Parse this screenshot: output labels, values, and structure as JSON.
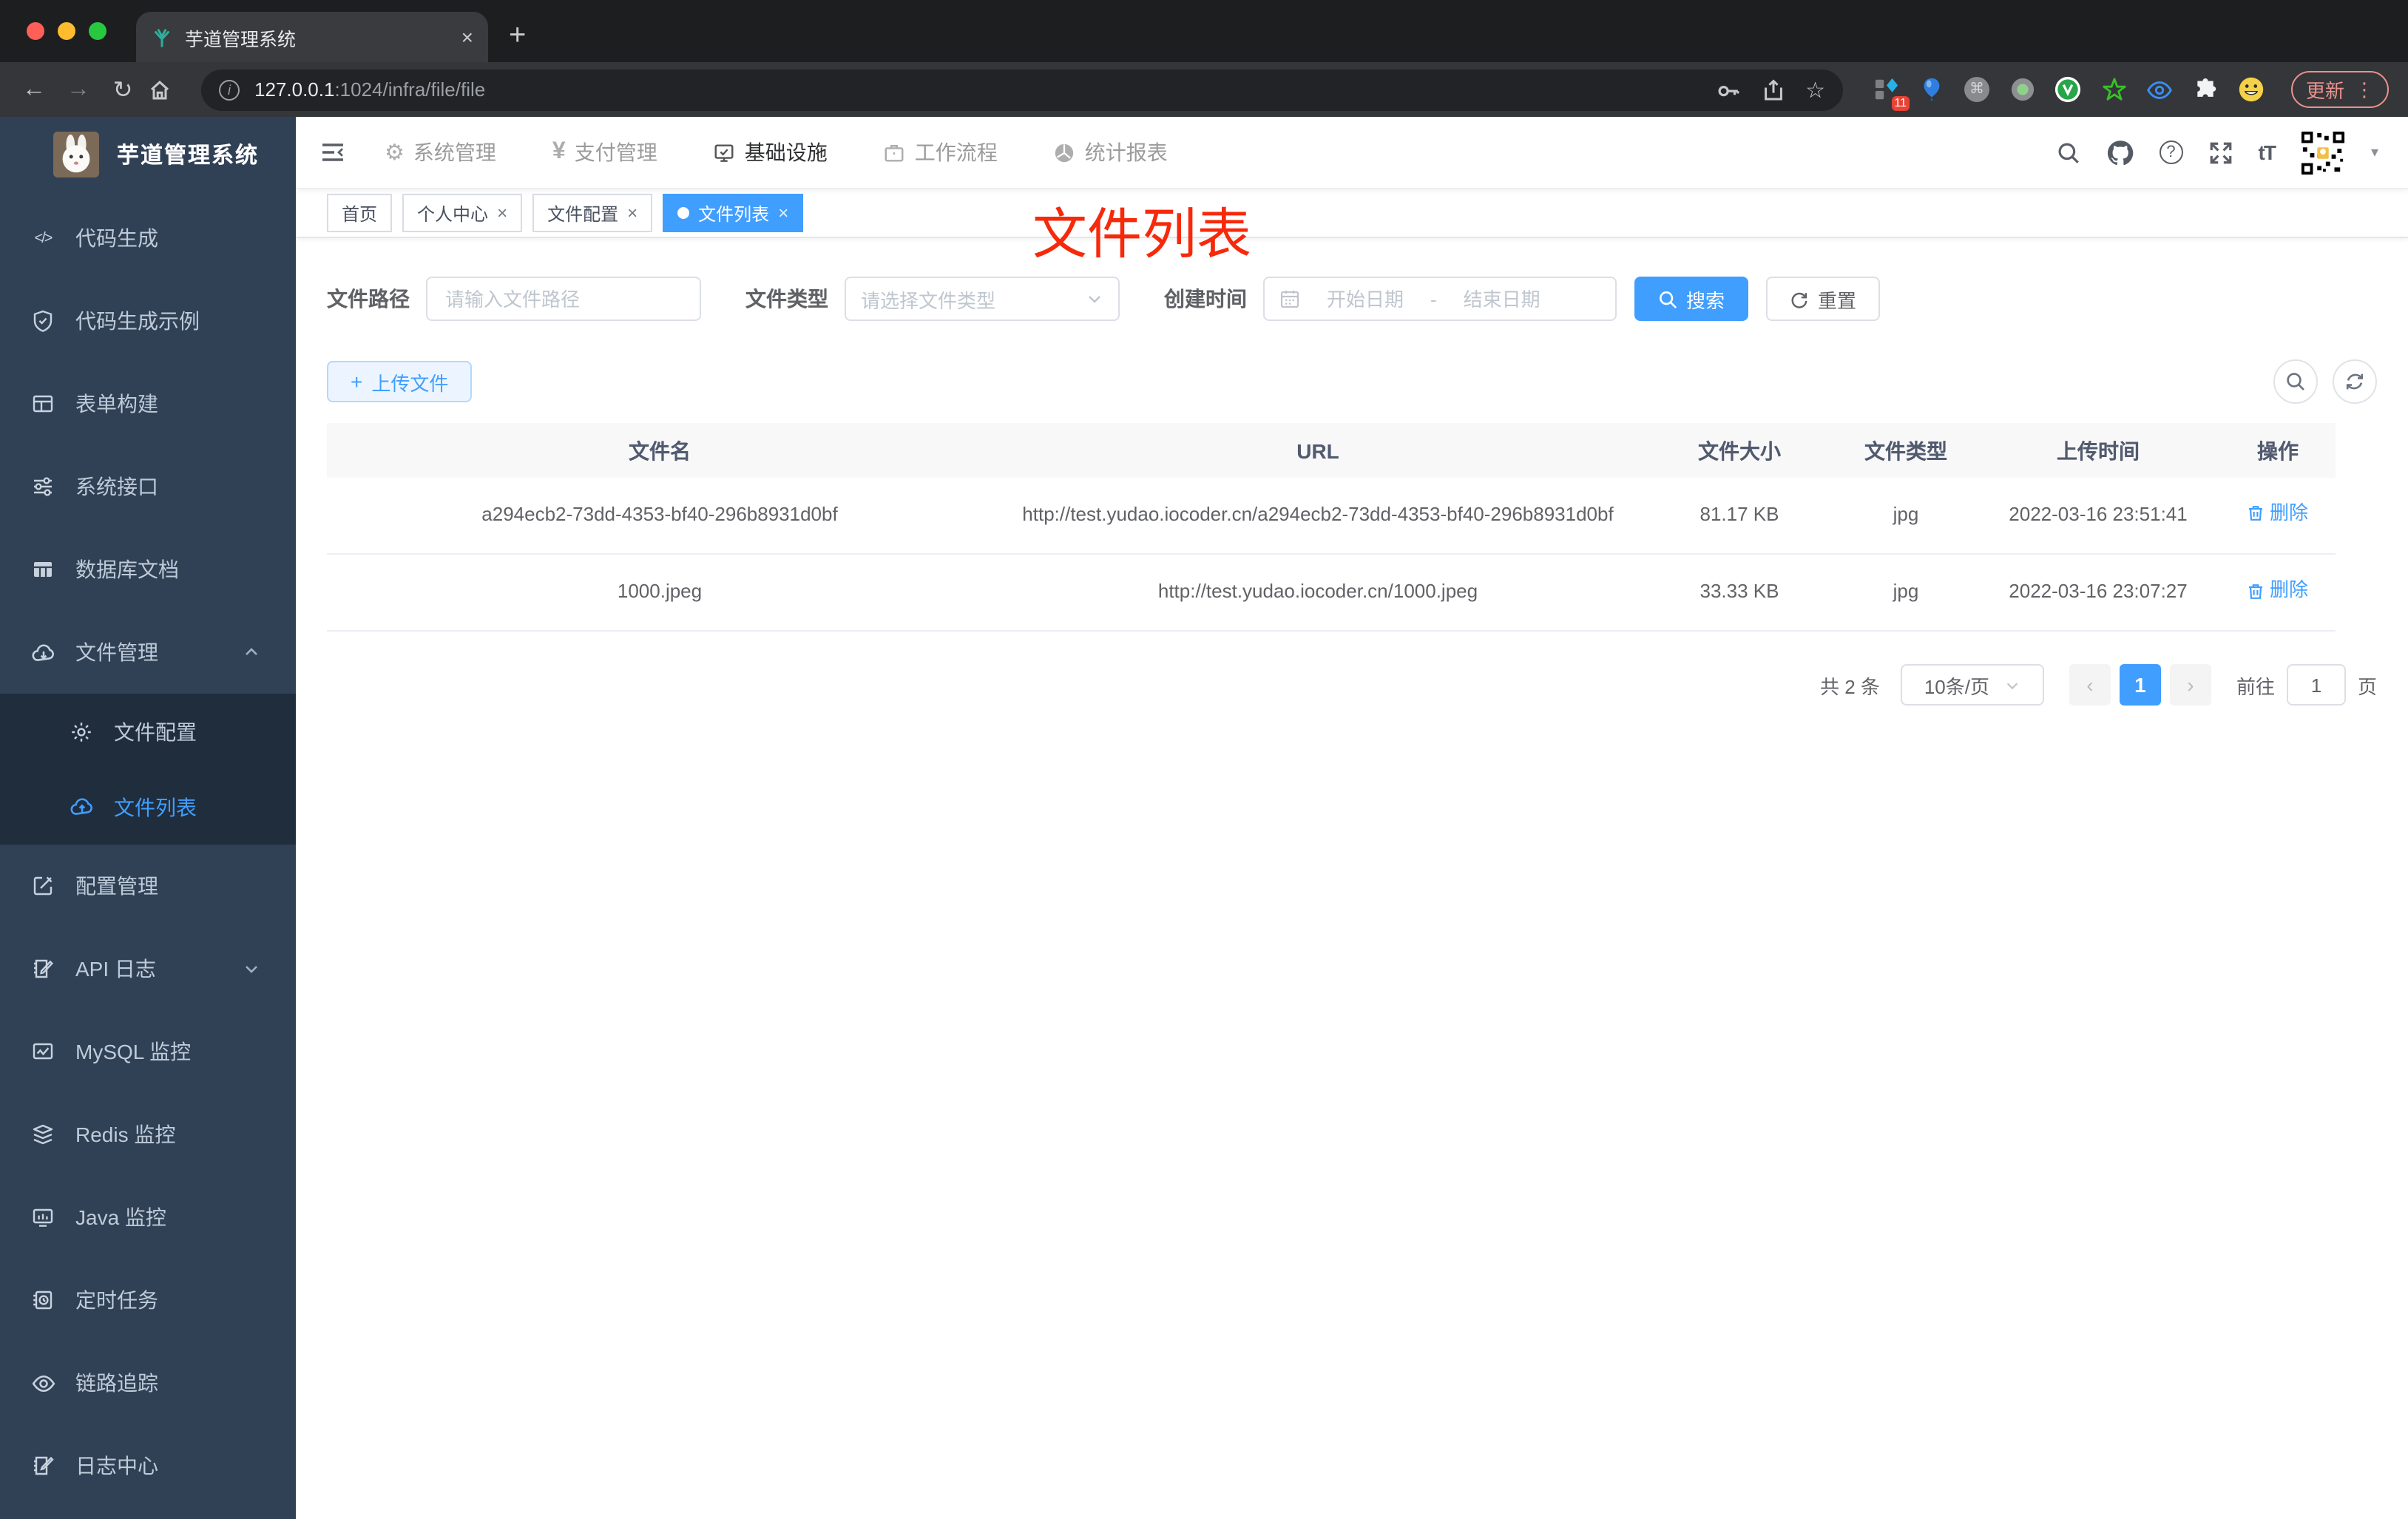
{
  "browser": {
    "tab_title": "芋道管理系统",
    "address": {
      "host": "127.0.0.1",
      "path": ":1024/infra/file/file"
    },
    "extension_badge": "11",
    "update_label": "更新"
  },
  "icons": {
    "close": "×",
    "plus": "+",
    "kebab": "⋮",
    "back": "←",
    "forward": "→",
    "reload": "↻",
    "star": "☆",
    "command": "⌘",
    "help": "?",
    "font_size": "tT",
    "caret_down": "▾",
    "gear": "⚙",
    "yen": "¥",
    "code": "</>",
    "prev": "‹",
    "next": "›",
    "info": "i"
  },
  "app_header": {
    "nav": [
      {
        "label": "系统管理"
      },
      {
        "label": "支付管理"
      },
      {
        "label": "基础设施"
      },
      {
        "label": "工作流程"
      },
      {
        "label": "统计报表"
      }
    ]
  },
  "sidebar": {
    "title": "芋道管理系统",
    "items": [
      {
        "label": "代码生成"
      },
      {
        "label": "代码生成示例"
      },
      {
        "label": "表单构建"
      },
      {
        "label": "系统接口"
      },
      {
        "label": "数据库文档"
      },
      {
        "label": "文件管理"
      },
      {
        "label": "文件配置"
      },
      {
        "label": "文件列表"
      },
      {
        "label": "配置管理"
      },
      {
        "label": "API 日志"
      },
      {
        "label": "MySQL 监控"
      },
      {
        "label": "Redis 监控"
      },
      {
        "label": "Java 监控"
      },
      {
        "label": "定时任务"
      },
      {
        "label": "链路追踪"
      },
      {
        "label": "日志中心"
      }
    ]
  },
  "tags": {
    "items": [
      {
        "label": "首页"
      },
      {
        "label": "个人中心"
      },
      {
        "label": "文件配置"
      },
      {
        "label": "文件列表"
      }
    ]
  },
  "annotation": {
    "text": "文件列表",
    "color": "#f6290b"
  },
  "filters": {
    "path_label": "文件路径",
    "path_placeholder": "请输入文件路径",
    "type_label": "文件类型",
    "type_placeholder": "请选择文件类型",
    "date_label": "创建时间",
    "date_start_placeholder": "开始日期",
    "date_separator": "-",
    "date_end_placeholder": "结束日期",
    "search_label": "搜索",
    "reset_label": "重置"
  },
  "toolbar": {
    "upload_label": "上传文件"
  },
  "table": {
    "columns": [
      "文件名",
      "URL",
      "文件大小",
      "文件类型",
      "上传时间",
      "操作"
    ],
    "rows": [
      {
        "name": "a294ecb2-73dd-4353-bf40-296b8931d0bf",
        "url": "http://test.yudao.iocoder.cn/a294ecb2-73dd-4353-bf40-296b8931d0bf",
        "size": "81.17 KB",
        "type": "jpg",
        "time": "2022-03-16 23:51:41",
        "action": "删除"
      },
      {
        "name": "1000.jpeg",
        "url": "http://test.yudao.iocoder.cn/1000.jpeg",
        "size": "33.33 KB",
        "type": "jpg",
        "time": "2022-03-16 23:07:27",
        "action": "删除"
      }
    ]
  },
  "pagination": {
    "total": "共 2 条",
    "page_size": "10条/页",
    "current": "1",
    "goto_label": "前往",
    "goto_value": "1",
    "page_label": "页"
  },
  "colors": {
    "accent": "#409eff",
    "sidebar_bg": "#304156",
    "submenu_bg": "#1f2d3d",
    "annotation_red": "#f6290b"
  }
}
